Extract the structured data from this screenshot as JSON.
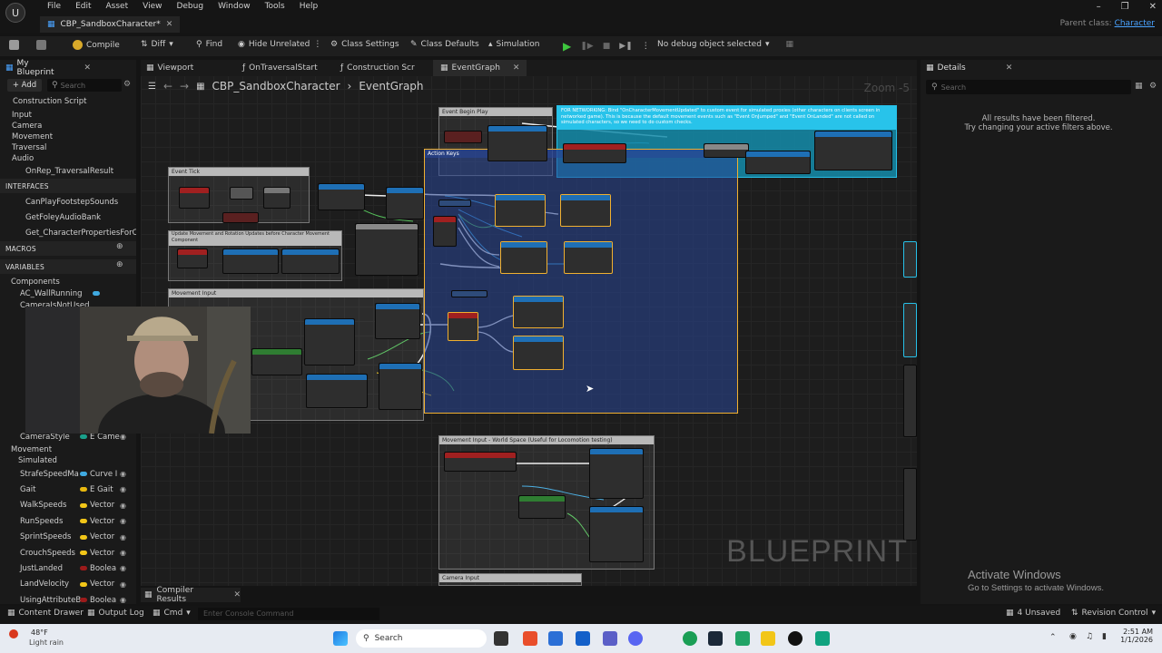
{
  "menubar": {
    "logo": "U",
    "menus": [
      "File",
      "Edit",
      "Asset",
      "View",
      "Debug",
      "Window",
      "Tools",
      "Help"
    ]
  },
  "doc_tab": {
    "title": "CBP_SandboxCharacter*"
  },
  "parent_class": {
    "label": "Parent class:",
    "value": "Character"
  },
  "toolbar": {
    "compile": "Compile",
    "diff": "Diff",
    "find": "Find",
    "hide_unrelated": "Hide Unrelated",
    "class_settings": "Class Settings",
    "class_defaults": "Class Defaults",
    "simulation": "Simulation",
    "debug_object": "No debug object selected"
  },
  "left_panel": {
    "tab": "My Blueprint",
    "add": "+ Add",
    "search_placeholder": "Search",
    "items_top": [
      "Construction Script",
      "Input",
      "Camera",
      "Movement",
      "Traversal",
      "Audio",
      "OnRep_TraversalResult"
    ],
    "interfaces_header": "INTERFACES",
    "interfaces": [
      "CanPlayFootstepSounds",
      "GetFoleyAudioBank",
      "Get_CharacterPropertiesForC"
    ],
    "macros_header": "MACROS",
    "variables_header": "VARIABLES",
    "components": "Components",
    "component_items": [
      "AC_WallRunning",
      "CameraIsNotUsed"
    ],
    "var_camera_style": {
      "name": "CameraStyle",
      "type": "E Came"
    },
    "movement": "Movement",
    "simulated": "Simulated",
    "variables": [
      {
        "name": "StrafeSpeedMa",
        "type": "Curve I",
        "color": "#3fa9e0"
      },
      {
        "name": "Gait",
        "type": "E Gait",
        "color": "#e8b80f"
      },
      {
        "name": "WalkSpeeds",
        "type": "Vector",
        "color": "#f2c618"
      },
      {
        "name": "RunSpeeds",
        "type": "Vector",
        "color": "#f2c618"
      },
      {
        "name": "SprintSpeeds",
        "type": "Vector",
        "color": "#f2c618"
      },
      {
        "name": "CrouchSpeeds",
        "type": "Vector",
        "color": "#f2c618"
      },
      {
        "name": "JustLanded",
        "type": "Boolea",
        "color": "#9c1b1b"
      },
      {
        "name": "LandVelocity",
        "type": "Vector",
        "color": "#f2c618"
      },
      {
        "name": "UsingAttributeB",
        "type": "Boolea",
        "color": "#9c1b1b"
      }
    ]
  },
  "graph": {
    "tabs": [
      "Viewport",
      "OnTraversalStart",
      "Construction Scr",
      "EventGraph"
    ],
    "breadcrumb": [
      "CBP_SandboxCharacter",
      "EventGraph"
    ],
    "zoom": "Zoom -5",
    "comments": {
      "event_tick": "Event Tick",
      "update_movement": "Update Movement and Rotation Updates before Character Movement Component",
      "movement_input": "Movement Input",
      "event_begin_play": "Event Begin Play",
      "action_keys": "Action Keys",
      "networking": "FOR NETWORKING: Bind \"OnCharacterMovementUpdated\" to custom event for simulated proxies (other characters on clients screen in networked game). This is because the default movement events such as \"Event OnJumped\" and \"Event OnLanded\" are not called on simulated characters, so we need to do custom checks.",
      "movement_input_world": "Movement Input - World Space (Useful for Locomotion testing)",
      "camera_input": "Camera Input"
    },
    "watermark": "BLUEPRINT"
  },
  "details": {
    "tab": "Details",
    "search_placeholder": "Search",
    "msg1": "All results have been filtered.",
    "msg2": "Try changing your active filters above."
  },
  "activate_windows": {
    "title": "Activate Windows",
    "sub": "Go to Settings to activate Windows."
  },
  "compiler_results": "Compiler Results",
  "statusbar": {
    "content_drawer": "Content Drawer",
    "output_log": "Output Log",
    "cmd": "Cmd",
    "console_placeholder": "Enter Console Command",
    "unsaved": "4 Unsaved",
    "revision": "Revision Control"
  },
  "taskbar": {
    "weather_temp": "48°F",
    "weather_desc": "Light rain",
    "search": "Search",
    "time": "2:51 AM",
    "date": "1/1/2026"
  }
}
